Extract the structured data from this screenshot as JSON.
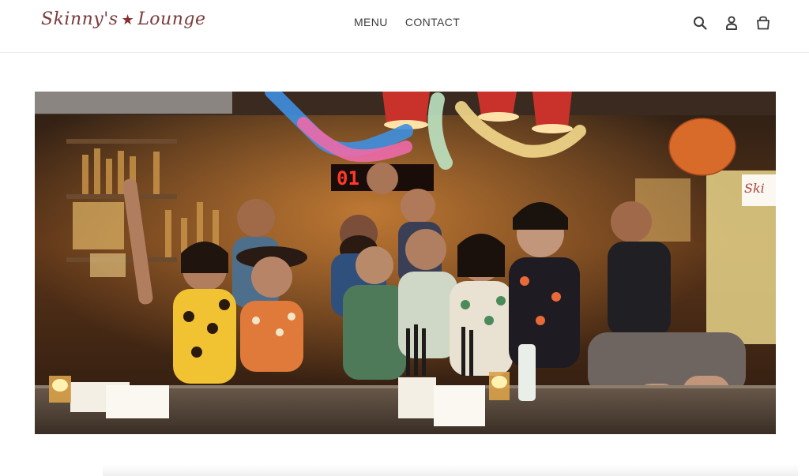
{
  "header": {
    "logo_part1": "Skinny's",
    "logo_star": "★",
    "logo_part2": "Lounge",
    "nav": [
      {
        "label": "MENU"
      },
      {
        "label": "CONTACT"
      }
    ],
    "icons": [
      "search-icon",
      "account-icon",
      "cart-icon"
    ]
  },
  "hero": {
    "image_subject": "Group photo of bar staff and guests behind the bar counter",
    "clock_text": "01  40",
    "sign_text": "Ski"
  },
  "colors": {
    "logo": "#7a3b3b",
    "nav_text": "#3d3d3d",
    "background": "#ffffff"
  }
}
